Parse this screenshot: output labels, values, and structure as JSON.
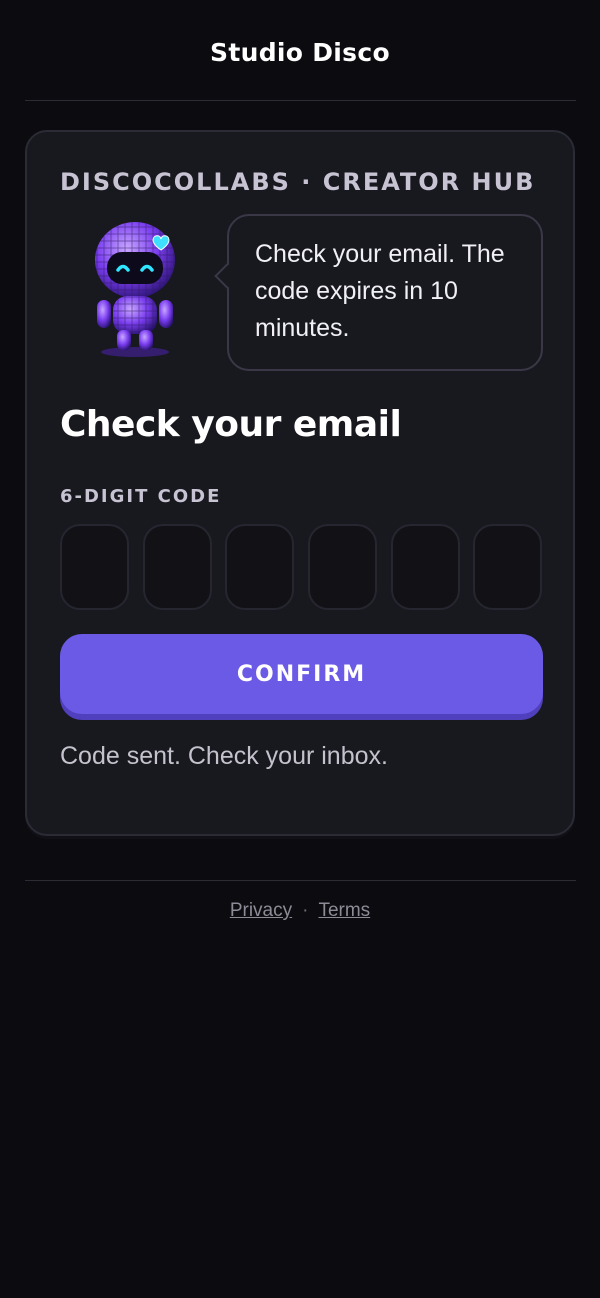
{
  "header": {
    "title": "Studio Disco"
  },
  "card": {
    "eyebrow": "DISCOCOLLABS · CREATOR HUB",
    "mascot_icon": "disco-ball-robot",
    "bubble_text": "Check your email. The code expires in 10 minutes.",
    "heading": "Check your email",
    "code_label": "6-DIGIT CODE",
    "code_digits": [
      "",
      "",
      "",
      "",
      "",
      ""
    ],
    "confirm_label": "CONFIRM",
    "status": "Code sent. Check your inbox."
  },
  "footer": {
    "privacy": "Privacy",
    "separator": "·",
    "terms": "Terms"
  },
  "colors": {
    "background": "#0b0b10",
    "card": "#18181f",
    "accent": "#6b5ae6"
  }
}
